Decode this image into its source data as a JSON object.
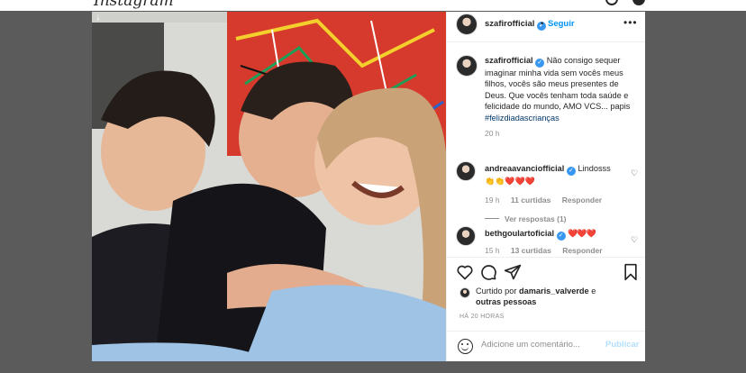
{
  "brand": {
    "logo_text": "Instagram"
  },
  "post": {
    "author": {
      "username": "szafirofficial",
      "follow_label": "Seguir",
      "more_label": "•••"
    },
    "caption": {
      "username": "szafirofficial",
      "text": "Não consigo sequer imaginar minha vida sem vocês meus filhos, vocês são meus presentes de Deus. Que vocês tenham toda saúde e felicidade do mundo, AMO VCS... papis",
      "hashtag": "#felizdiadascrianças",
      "time": "20 h"
    },
    "comments": [
      {
        "username": "andreaavanciofficial",
        "text": "Lindosss",
        "emoji": "👏👏❤️❤️❤️",
        "time": "19 h",
        "likes": "11 curtidas",
        "reply_label": "Responder",
        "view_replies": "Ver respostas (1)"
      },
      {
        "username": "bethgoulartoficial",
        "emoji": "❤️❤️❤️",
        "time": "15 h",
        "likes": "13 curtidas",
        "reply_label": "Responder"
      }
    ],
    "liked_by": {
      "prefix": "Curtido por",
      "user": "damaris_valverde",
      "connector": "e",
      "others": "outras pessoas"
    },
    "timestamp": "HÁ 20 HORAS",
    "comment_input": {
      "placeholder": "Adicione um comentário...",
      "publish_label": "Publicar"
    },
    "icons": [
      "heart-icon",
      "comment-icon",
      "share-icon",
      "bookmark-icon",
      "emoji-icon",
      "verified-icon",
      "download-arrow-icon"
    ],
    "colors": {
      "link_blue": "#0095f6",
      "verified_blue": "#3897f0",
      "heart_red": "#e0245e",
      "muted": "#8e8e8e"
    }
  }
}
